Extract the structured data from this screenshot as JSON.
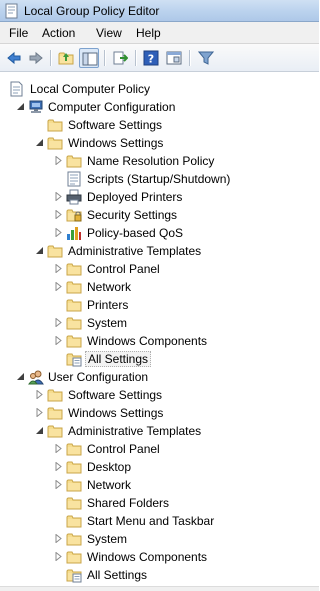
{
  "window": {
    "title": "Local Group Policy Editor"
  },
  "menu": {
    "file": "File",
    "action": "Action",
    "view": "View",
    "help": "Help"
  },
  "toolbar_icons": [
    "back-arrow-icon",
    "forward-arrow-icon",
    "up-folder-icon",
    "show-hide-tree-icon",
    "export-list-icon",
    "help-icon",
    "properties-icon",
    "filter-icon"
  ],
  "tree": {
    "root": "Local Computer Policy",
    "computer": {
      "label": "Computer Configuration",
      "software": "Software Settings",
      "windows": {
        "label": "Windows Settings",
        "name_resolution": "Name Resolution Policy",
        "scripts": "Scripts (Startup/Shutdown)",
        "printers": "Deployed Printers",
        "security": "Security Settings",
        "qos": "Policy-based QoS"
      },
      "admin": {
        "label": "Administrative Templates",
        "control_panel": "Control Panel",
        "network": "Network",
        "printers": "Printers",
        "system": "System",
        "components": "Windows Components",
        "all": "All Settings"
      }
    },
    "user": {
      "label": "User Configuration",
      "software": "Software Settings",
      "windows": "Windows Settings",
      "admin": {
        "label": "Administrative Templates",
        "control_panel": "Control Panel",
        "desktop": "Desktop",
        "network": "Network",
        "shared_folders": "Shared Folders",
        "start_menu": "Start Menu and Taskbar",
        "system": "System",
        "components": "Windows Components",
        "all": "All Settings"
      }
    }
  },
  "colors": {
    "folder": "#f2d27a",
    "selection": "#f3f3f3",
    "titlebar": "#bcd3ee"
  }
}
